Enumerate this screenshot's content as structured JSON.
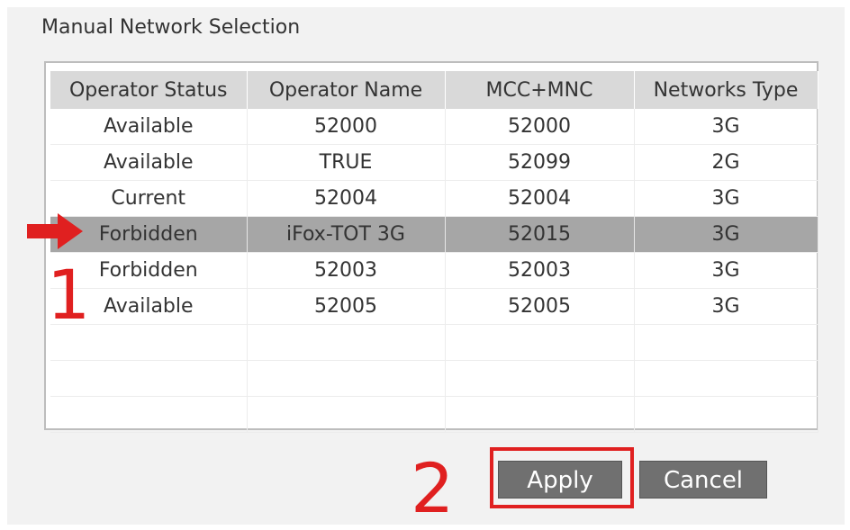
{
  "group_title": "Manual Network Selection",
  "table": {
    "columns": [
      "Operator Status",
      "Operator Name",
      "MCC+MNC",
      "Networks Type"
    ],
    "rows": [
      [
        "Available",
        "52000",
        "52000",
        "3G"
      ],
      [
        "Available",
        "TRUE",
        "52099",
        "2G"
      ],
      [
        "Current",
        "52004",
        "52004",
        "3G"
      ],
      [
        "Forbidden",
        "iFox-TOT 3G",
        "52015",
        "3G"
      ],
      [
        "Forbidden",
        "52003",
        "52003",
        "3G"
      ],
      [
        "Available",
        "52005",
        "52005",
        "3G"
      ],
      [
        "",
        "",
        "",
        ""
      ],
      [
        "",
        "",
        "",
        ""
      ],
      [
        "",
        "",
        "",
        ""
      ]
    ],
    "selected_row": 3
  },
  "annotations": {
    "step1": "1",
    "step2": "2",
    "color": "#e02020",
    "arrow_icon": "red-arrow-icon"
  },
  "buttons": {
    "apply": "Apply",
    "cancel": "Cancel"
  }
}
